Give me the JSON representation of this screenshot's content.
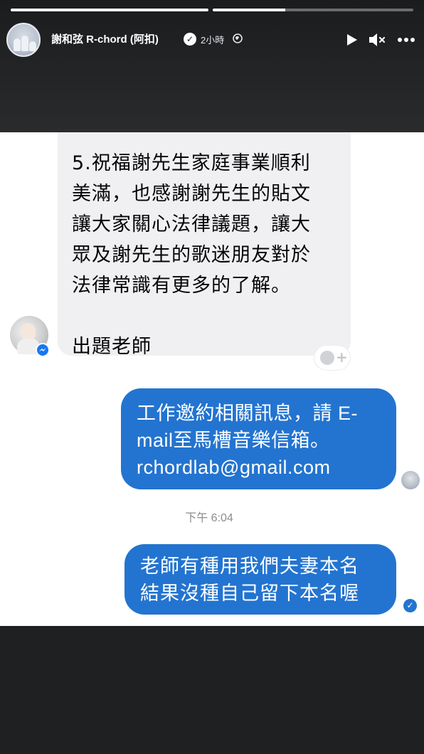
{
  "story": {
    "progress": [
      1.0,
      0.36
    ],
    "username": "謝和弦 R-chord (阿扣)",
    "time": "2小時",
    "icons": {
      "verified": "verified-badge-icon",
      "privacy": "globe-icon",
      "play": "play-icon",
      "mute": "muted-speaker-icon",
      "more": "more-dots-icon"
    }
  },
  "chat": {
    "incoming_message": "5.祝福謝先生家庭事業順利\n美滿，也感謝謝先生的貼文\n讓大家關心法律議題，讓大\n眾及謝先生的歌迷朋友對於\n法律常識有更多的了解。\n\n出題老師",
    "outgoing_auto_reply": "工作邀約相關訊息，請 E-\nmail至馬槽音樂信箱。\nrchordlab@gmail.com",
    "timestamp": "下午 6:04",
    "outgoing_message": "老師有種用我們夫妻本名\n結果沒種自己留下本名喔",
    "colors": {
      "outgoing_bubble": "#2374d0",
      "incoming_bubble": "#f0f0f2",
      "messenger_badge": "#1877f2"
    }
  }
}
